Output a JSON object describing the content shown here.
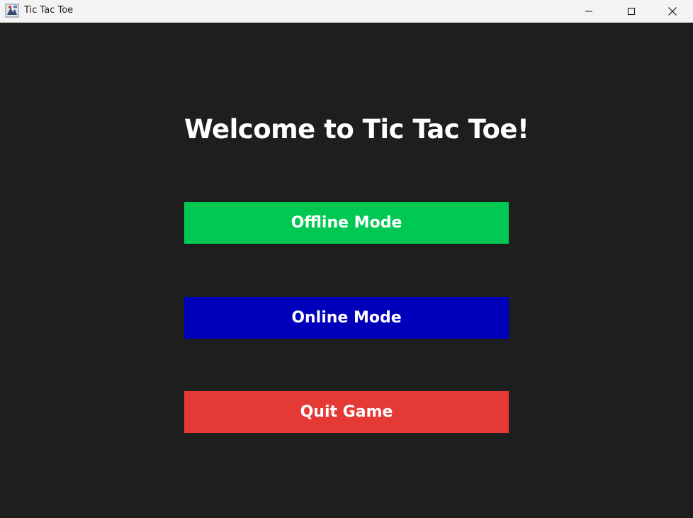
{
  "window": {
    "title": "Tic Tac Toe",
    "controls": {
      "minimize": "minimize-icon",
      "maximize": "maximize-icon",
      "close": "close-icon"
    }
  },
  "main": {
    "heading": "Welcome to Tic Tac Toe!",
    "buttons": {
      "offline": {
        "label": "Offline Mode",
        "color": "#00c853"
      },
      "online": {
        "label": "Online Mode",
        "color": "#0000bb"
      },
      "quit": {
        "label": "Quit Game",
        "color": "#e53935"
      }
    }
  },
  "colors": {
    "background": "#1e1e1e",
    "titlebar": "#f3f3f3",
    "text": "#ffffff"
  }
}
